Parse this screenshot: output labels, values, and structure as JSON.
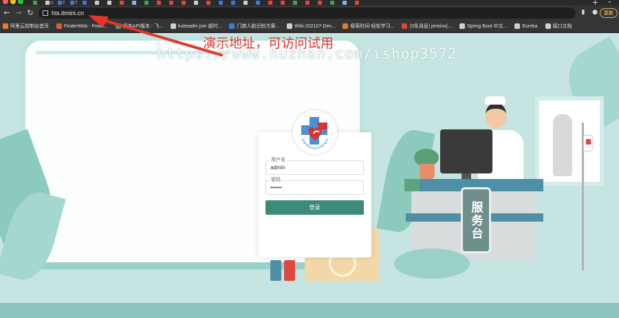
{
  "browser": {
    "url": "his.itmini.cn",
    "update_label": "更新",
    "tabs": [
      {
        "label": "",
        "color": "#4a9b5c"
      },
      {
        "label": "p|",
        "color": "#cfcfcf"
      },
      {
        "label": "Z",
        "color": "#3a7bd5"
      },
      {
        "label": "Z",
        "color": "#3a7bd5"
      },
      {
        "label": "",
        "color": "#3a7bd5"
      },
      {
        "label": "",
        "color": "#cfcfcf"
      },
      {
        "label": "",
        "color": "#cfcfcf"
      },
      {
        "label": "",
        "color": "#e0463d"
      },
      {
        "label": "",
        "color": "#8fb3d9"
      },
      {
        "label": "",
        "color": "#4a9b5c"
      },
      {
        "label": "",
        "color": "#e0463d"
      },
      {
        "label": "",
        "color": "#e0463d"
      },
      {
        "label": "",
        "color": "#e0463d"
      },
      {
        "label": "",
        "color": "#cfcfcf"
      },
      {
        "label": "",
        "color": "#e0463d"
      },
      {
        "label": "",
        "color": "#3a7bd5"
      },
      {
        "label": "",
        "color": "#3a7bd5"
      },
      {
        "label": "",
        "color": "#cfcfcf"
      },
      {
        "label": "",
        "color": "#3a7bd5"
      },
      {
        "label": "",
        "color": "#e0463d"
      },
      {
        "label": "",
        "color": "#e0463d"
      },
      {
        "label": "",
        "color": "#4a9b5c"
      },
      {
        "label": "",
        "color": "#e0463d"
      },
      {
        "label": "",
        "color": "#e0463d"
      },
      {
        "label": "",
        "color": "#4a9b5c"
      },
      {
        "label": "",
        "color": "#8fb3d9"
      },
      {
        "label": "",
        "color": "#e0463d"
      }
    ]
  },
  "bookmarks": [
    {
      "label": "阿里云控制台首页",
      "color": "#f27a24"
    },
    {
      "label": "FinderWeb - Powe...",
      "color": "#e05c3a"
    },
    {
      "label": "服务API版本 - 飞...",
      "color": "#4a9b5c"
    },
    {
      "label": "kubeadm join 超时...",
      "color": "#cfcfcf"
    },
    {
      "label": "门禁人脸识别方案...",
      "color": "#3a7bd5"
    },
    {
      "label": "Wiki-202107-Dev...",
      "color": "#cfcfcf"
    },
    {
      "label": "极客时间-轻松学习...",
      "color": "#f27a24"
    },
    {
      "label": "(3条消息) jenkins(...",
      "color": "#e0463d"
    },
    {
      "label": "Spring Boot 中文...",
      "color": "#cfcfcf"
    },
    {
      "label": "Eureka",
      "color": "#cfcfcf"
    },
    {
      "label": "接口文档",
      "color": "#cfcfcf"
    }
  ],
  "annotation": {
    "demo_note": "演示地址，可访问试用",
    "watermark": "https://www.huzhan.com/ishop3572"
  },
  "desk_sign": "服务台",
  "login": {
    "username_label": "用户名",
    "username_value": "admin",
    "password_label": "密码",
    "password_value": "••••••",
    "submit_label": "登录"
  },
  "colors": {
    "primary_button": "#3e8a79",
    "annotation_red": "#e4362d",
    "background_teal": "#c6e5e2"
  }
}
